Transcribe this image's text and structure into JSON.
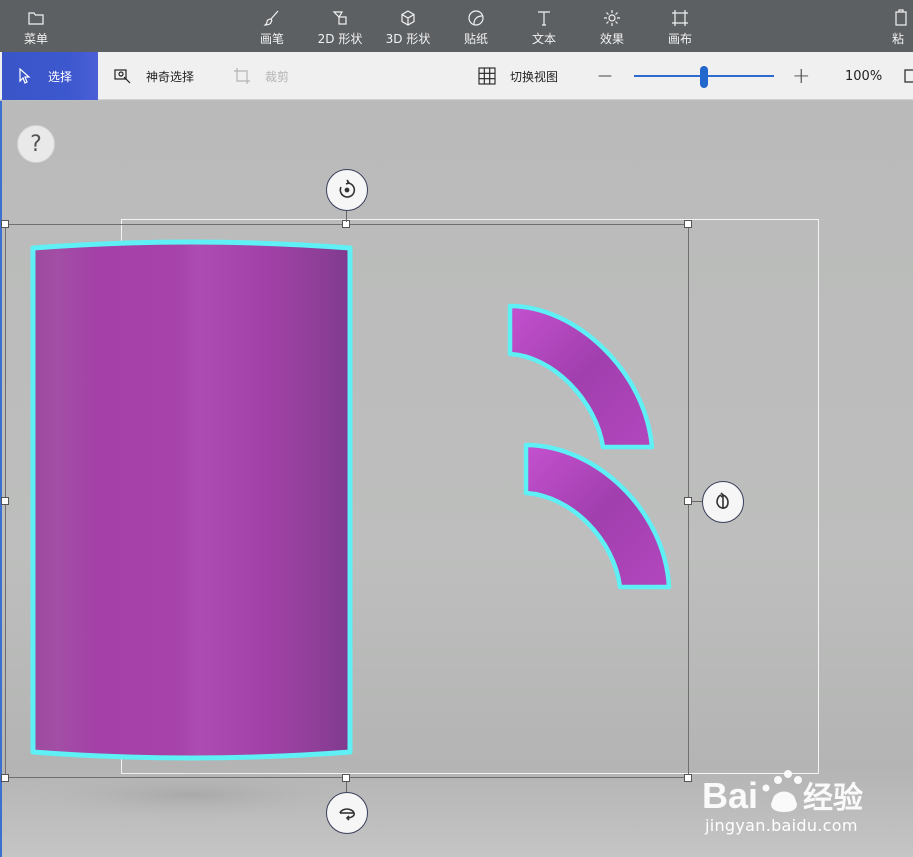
{
  "topbar": {
    "items": [
      {
        "label": "菜单",
        "icon": "folder-icon"
      },
      {
        "label": "画笔",
        "icon": "brush-icon"
      },
      {
        "label": "2D 形状",
        "icon": "2d-shapes-icon"
      },
      {
        "label": "3D 形状",
        "icon": "3d-cube-icon"
      },
      {
        "label": "贴纸",
        "icon": "sticker-icon"
      },
      {
        "label": "文本",
        "icon": "text-icon"
      },
      {
        "label": "效果",
        "icon": "effects-sun-icon"
      },
      {
        "label": "画布",
        "icon": "canvas-crop-icon"
      },
      {
        "label": "粘",
        "icon": "paste-icon"
      }
    ]
  },
  "subbar": {
    "select_label": "选择",
    "magic_select_label": "神奇选择",
    "crop_label": "裁剪",
    "toggle_view_label": "切换视图",
    "zoom_value": "100%",
    "zoom_minus": "—",
    "zoom_plus": "+",
    "zoom_slider_fraction": 0.5
  },
  "canvas": {
    "help_label": "?"
  },
  "colors": {
    "accent": "#3d58ce",
    "shape_purple": "#a341a8",
    "outline_cyan": "#5ff0f5"
  },
  "watermark": {
    "brand": "Baidu经验",
    "url": "jingyan.baidu.com"
  }
}
